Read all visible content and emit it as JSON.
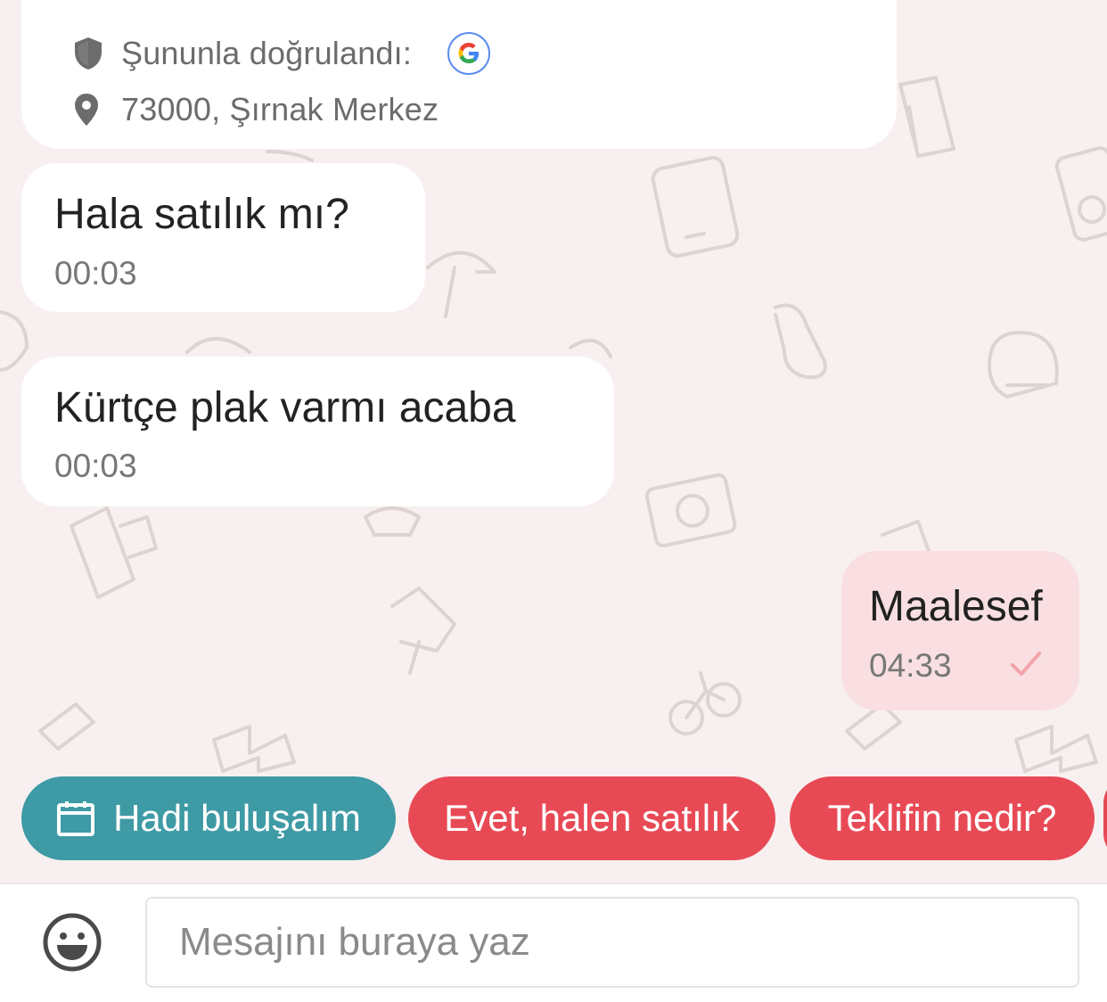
{
  "colors": {
    "background": "#f8f0f0",
    "bubble_incoming": "#ffffff",
    "bubble_outgoing": "#f9dfe1",
    "quick_reply_teal": "#3e9aa5",
    "quick_reply_red": "#e84a55",
    "tick": "#f2a3aa"
  },
  "profile_card": {
    "verified_label": "Şununla doğrulandı:",
    "verified_provider_icon": "google-icon",
    "location": "73000, Şırnak Merkez"
  },
  "messages": [
    {
      "direction": "incoming",
      "text": "Hala satılık mı?",
      "time": "00:03"
    },
    {
      "direction": "incoming",
      "text": "Kürtçe plak varmı acaba",
      "time": "00:03"
    },
    {
      "direction": "outgoing",
      "text": "Maalesef",
      "time": "04:33",
      "status_icon": "check-icon"
    }
  ],
  "quick_replies": [
    {
      "label": "Hadi buluşalım",
      "icon": "calendar-icon",
      "color": "teal"
    },
    {
      "label": "Evet, halen satılık",
      "color": "red"
    },
    {
      "label": "Teklifin nedir?",
      "color": "red"
    }
  ],
  "composer": {
    "placeholder": "Mesajını buraya yaz",
    "emoji_icon": "smiley-icon"
  }
}
